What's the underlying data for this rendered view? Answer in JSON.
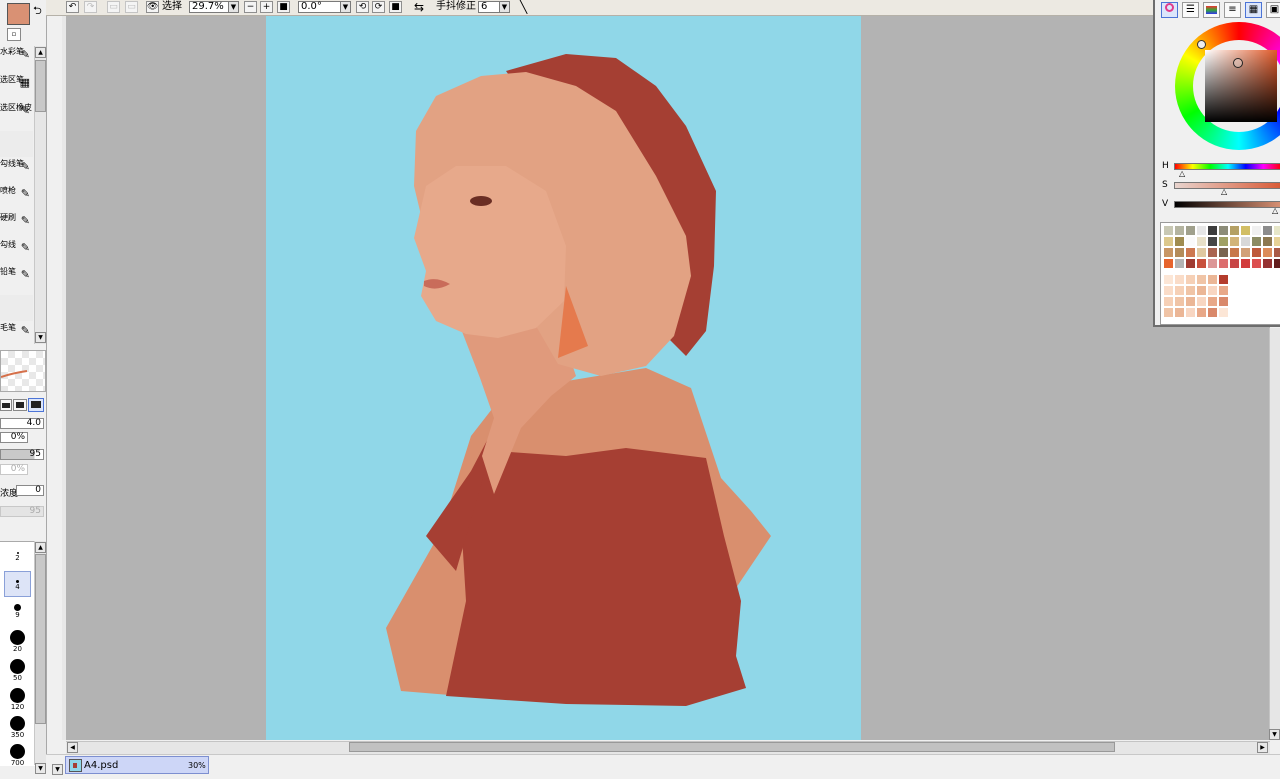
{
  "toolbar": {
    "view_label": "选择",
    "zoom_value": "29.7%",
    "angle_value": "0.0°",
    "stabilizer_label": "手抖修正",
    "stabilizer_value": "6"
  },
  "left_panel": {
    "tools": [
      {
        "label": "水彩笔"
      },
      {
        "label": "选区笔"
      },
      {
        "label": "选区橡皮"
      },
      {
        "label": "勾线笔"
      },
      {
        "label": "喷枪"
      },
      {
        "label": "硬刷"
      },
      {
        "label": "勾线"
      },
      {
        "label": "铅笔"
      },
      {
        "label": "毛笔"
      }
    ],
    "brush_size": "4.0",
    "min_size": "0%",
    "density": "95",
    "blending": "0%",
    "dilution_label": "浓度",
    "dilution_value": "0",
    "persistence": "95",
    "brush_sizes": [
      "2",
      "4",
      "9",
      "20",
      "50",
      "120",
      "350",
      "700"
    ]
  },
  "document": {
    "tab_name": "A4.psd",
    "tab_zoom": "30%"
  },
  "color_panel": {
    "h_label": "H",
    "s_label": "S",
    "v_label": "V",
    "current_color": "#d99174",
    "canvas_bg": "#90d7e8"
  }
}
